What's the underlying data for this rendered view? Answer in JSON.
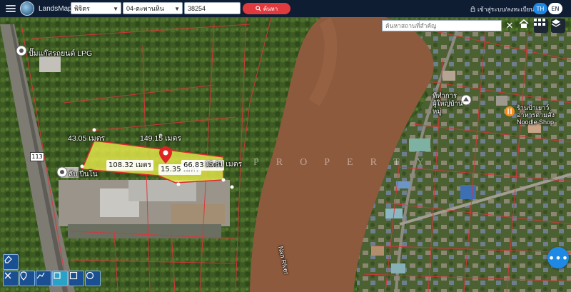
{
  "header": {
    "brand": "LandsMaps",
    "province": "พิจิตร",
    "district": "04-ตะพานหิน",
    "parcel_number": "38254",
    "search_label": "ค้นหา",
    "login_label": "เข้าสู่ระบบ/ลงทะเบียน",
    "lang_th": "TH",
    "lang_en": "EN"
  },
  "map": {
    "place_search_placeholder": "ค้นหาสถานที่สำคัญ",
    "labels": {
      "gas_station": "ปั๊มแก๊สรถยนต์ LPG",
      "pond": "ลับ ปีนโน",
      "road_number": "113",
      "temple": "ที่ทำการ ผู้ใหญ่บ้าน หมู่",
      "shop": "ร้านป้าเยาว์ อาหารตามสั่ง Noodle Shop",
      "river": "Nan River",
      "watermark": "PROPERTY"
    },
    "measurements": {
      "m1": "43.05 เมตร",
      "m2": "149.15 เมตร",
      "m3": "108.32 เมตร",
      "m4": "15.35 เมตร",
      "m5": "66.83 เมตร",
      "m6": "15.81 เมตร"
    }
  },
  "colors": {
    "topbar": "#0f1d33",
    "search_button": "#e03a3e",
    "parcel_fill": "#e8ec4a",
    "parcel_border": "#d92b2b",
    "lang_active": "#1e88e5"
  }
}
